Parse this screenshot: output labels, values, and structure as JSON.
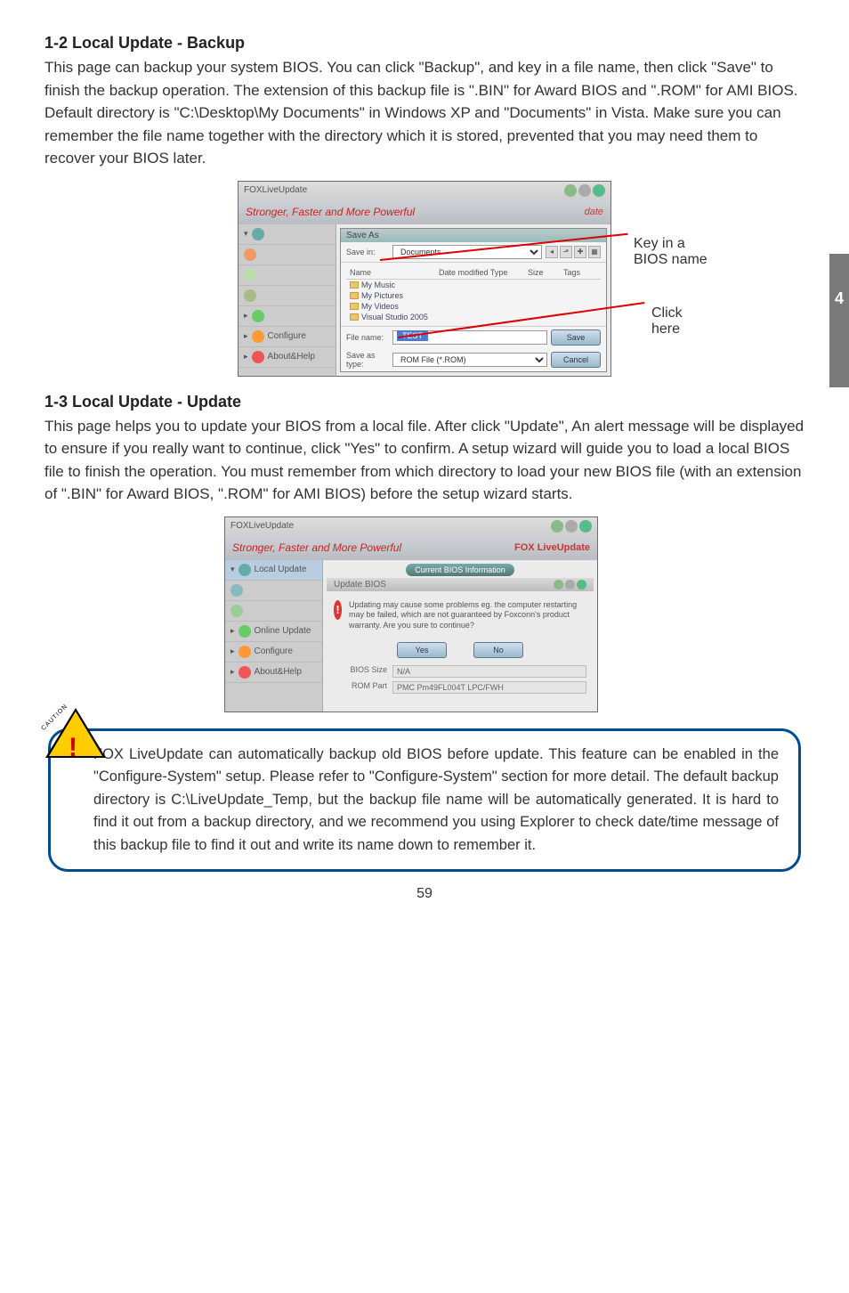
{
  "side_tab": "4",
  "page_number": "59",
  "section1": {
    "title": "1-2 Local Update - Backup",
    "body": "This page can backup your system BIOS. You can click \"Backup\", and key in a file name, then click \"Save\" to finish the backup operation. The extension of this backup file is \".BIN\" for Award BIOS and \".ROM\" for AMI BIOS. Default directory is \"C:\\Desktop\\My Documents\" in Windows XP and \"Documents\" in Vista. Make sure you can remember the file name together with the directory which it is stored, prevented that you may need them to recover your BIOS later."
  },
  "shot1": {
    "title": "FOXLiveUpdate",
    "banner_left": "Stronger, Faster and More Powerful",
    "banner_right": "date",
    "nav": {
      "configure": "Configure",
      "about": "About&Help"
    },
    "saveas": {
      "title": "Save As",
      "savein_label": "Save in:",
      "savein_value": "Documents",
      "columns": {
        "name": "Name",
        "date": "Date modified Type",
        "size": "Size",
        "tags": "Tags"
      },
      "items": [
        "My Music",
        "My Pictures",
        "My Videos",
        "Visual Studio 2005"
      ],
      "filename_label": "File name:",
      "filename_value": "TEST",
      "savetype_label": "Save as type:",
      "savetype_value": "ROM File (*.ROM)",
      "save_btn": "Save",
      "cancel_btn": "Cancel"
    },
    "annot_key": "Key in a BIOS name",
    "annot_click": "Click here"
  },
  "section2": {
    "title": "1-3 Local Update - Update",
    "body": "This page helps you to update your BIOS from a local file. After click \"Update\", An alert message will be displayed to ensure if you really want to continue, click \"Yes\" to confirm. A setup wizard will guide you to load a local BIOS file to finish the operation. You must remember from which directory to load your new BIOS file (with an extension of \".BIN\" for Award BIOS, \".ROM\" for AMI BIOS) before the setup wizard starts."
  },
  "shot2": {
    "title": "FOXLiveUpdate",
    "banner_left": "Stronger, Faster and More Powerful",
    "banner_right": "FOX LiveUpdate",
    "nav": {
      "local": "Local Update",
      "online": "Online Update",
      "configure": "Configure",
      "about": "About&Help"
    },
    "info_bar": "Current BIOS Information",
    "sub_tab": "Update BIOS",
    "msg": "Updating may cause some problems eg. the computer restarting may be failed, which are not guaranteed by Foxconn's product warranty. Are you sure to continue?",
    "yes": "Yes",
    "no": "No",
    "rows": {
      "bios_size_label": "BIOS Size",
      "bios_size_value": "N/A",
      "rom_part_label": "ROM Part",
      "rom_part_value": "PMC Pm49FL004T LPC/FWH"
    }
  },
  "caution": {
    "label": "CAUTION",
    "mark": "!",
    "text": "FOX LiveUpdate can automatically backup old BIOS before update. This feature can be enabled in the \"Configure-System\" setup. Please refer to \"Configure-System\" section for more detail. The default backup directory is C:\\LiveUpdate_Temp, but the backup file name will be automatically generated. It is hard to find it out from a backup directory, and we recommend you using Explorer to check date/time message of this backup file to find it out and write its name down to remember it."
  }
}
